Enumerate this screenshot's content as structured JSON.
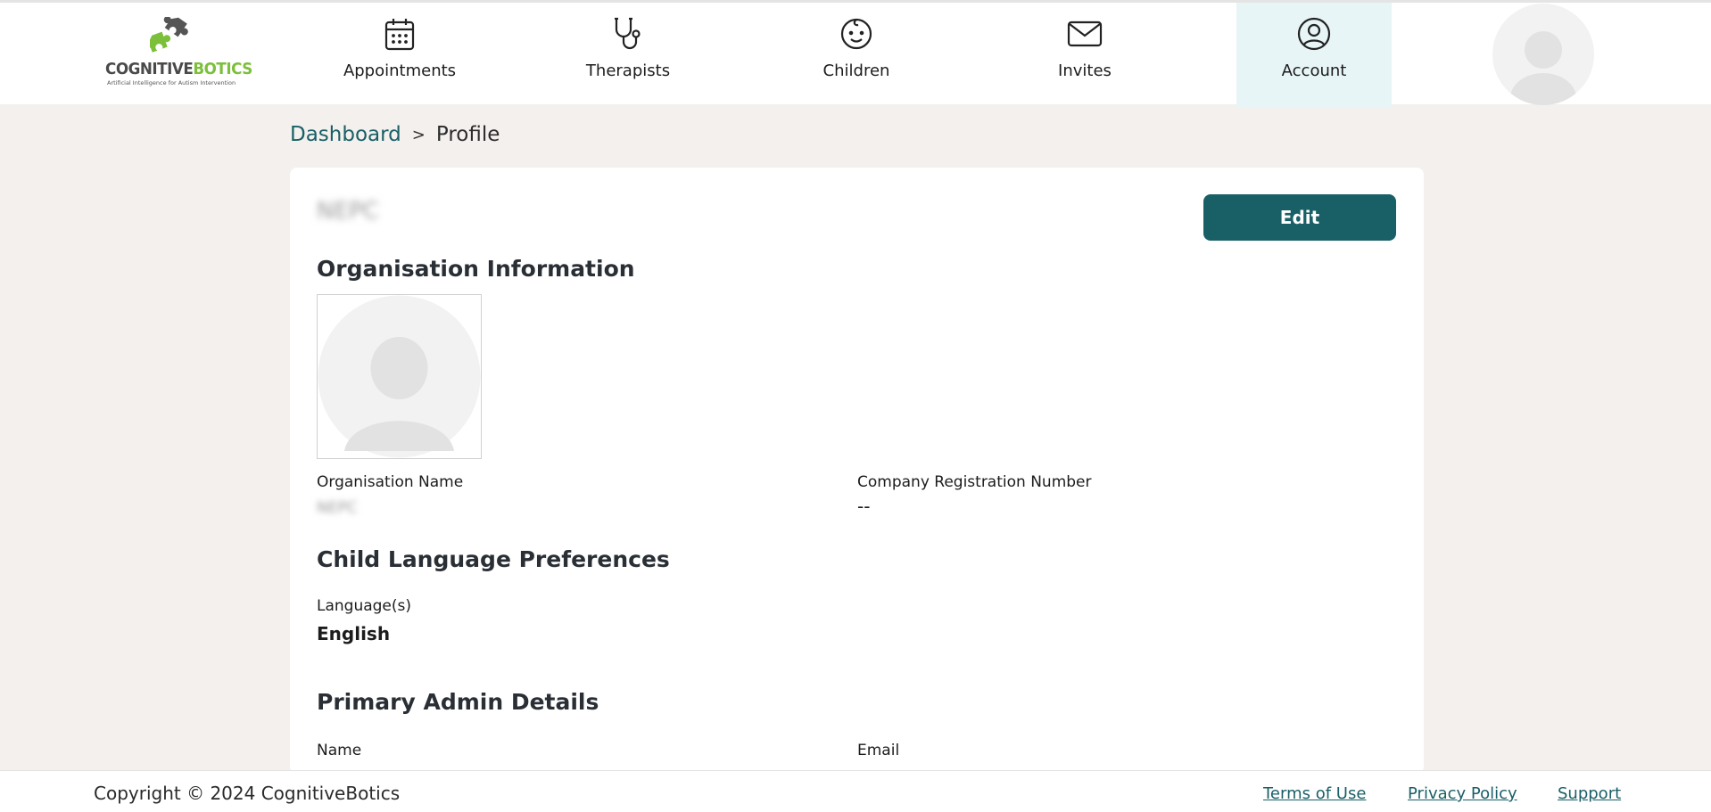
{
  "brand": {
    "word_1": "COGNITIVE",
    "word_2": "BOTICS",
    "tagline": "Artificial Intelligence for Autism Intervention"
  },
  "nav": {
    "items": [
      {
        "label": "Appointments",
        "icon": "calendar-icon"
      },
      {
        "label": "Therapists",
        "icon": "stethoscope-icon"
      },
      {
        "label": "Children",
        "icon": "baby-face-icon"
      },
      {
        "label": "Invites",
        "icon": "envelope-icon"
      },
      {
        "label": "Account",
        "icon": "user-circle-icon",
        "active": true
      }
    ]
  },
  "breadcrumb": {
    "parent": "Dashboard",
    "separator": ">",
    "current": "Profile"
  },
  "profile": {
    "org_heading_blurred": "NEPC",
    "edit_label": "Edit",
    "org_info_title": "Organisation Information",
    "org_name_label": "Organisation Name",
    "org_name_value": "NEPC",
    "reg_number_label": "Company Registration Number",
    "reg_number_value": "--",
    "lang_title": "Child Language Preferences",
    "lang_label": "Language(s)",
    "lang_value": "English",
    "admin_title": "Primary Admin Details",
    "admin_name_label": "Name",
    "admin_email_label": "Email"
  },
  "footer": {
    "copyright": "Copyright © 2024 CognitiveBotics",
    "terms": "Terms of Use",
    "privacy": "Privacy Policy",
    "support": "Support"
  },
  "colors": {
    "accent": "#195f66",
    "brand_green": "#7bbf3a",
    "active_nav_bg": "#e8f5f6",
    "page_bg": "#f3f0ed"
  }
}
